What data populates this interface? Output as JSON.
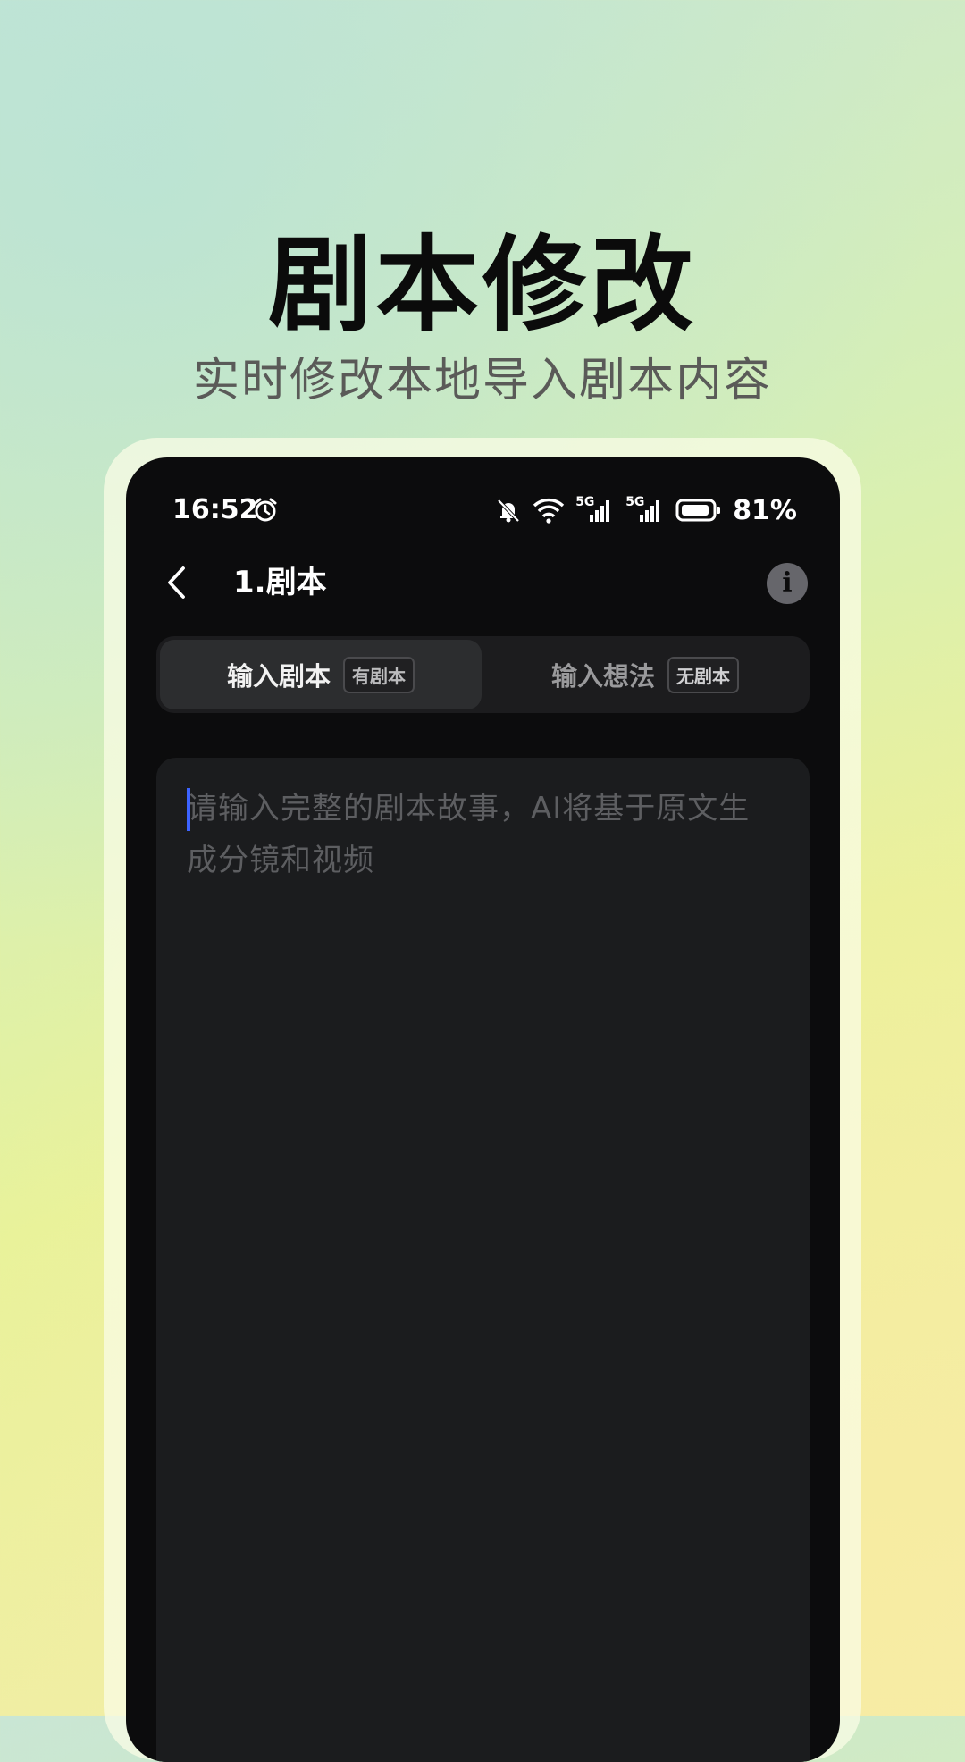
{
  "promo": {
    "headline": "剧本修改",
    "subline": "实时修改本地导入剧本内容"
  },
  "status_bar": {
    "time": "16:52",
    "battery": "81%",
    "network_1": "5G",
    "network_2": "5G",
    "icons": [
      "alarm-icon",
      "mute-bell-icon",
      "wifi-icon",
      "signal-icon",
      "signal-icon",
      "battery-icon"
    ]
  },
  "nav": {
    "title": "1.剧本",
    "back_icon": "chevron-left-icon",
    "info_label": "i"
  },
  "tabs": [
    {
      "label": "输入剧本",
      "badge": "有剧本",
      "active": true
    },
    {
      "label": "输入想法",
      "badge": "无剧本",
      "active": false
    }
  ],
  "editor": {
    "placeholder": "请输入完整的剧本故事，AI将基于原文生成分镜和视频",
    "caret_color": "#3c63ff"
  },
  "colors": {
    "screen_bg": "#0c0c0d",
    "card_bg": "#1b1c1e",
    "accent": "#3c63ff"
  }
}
